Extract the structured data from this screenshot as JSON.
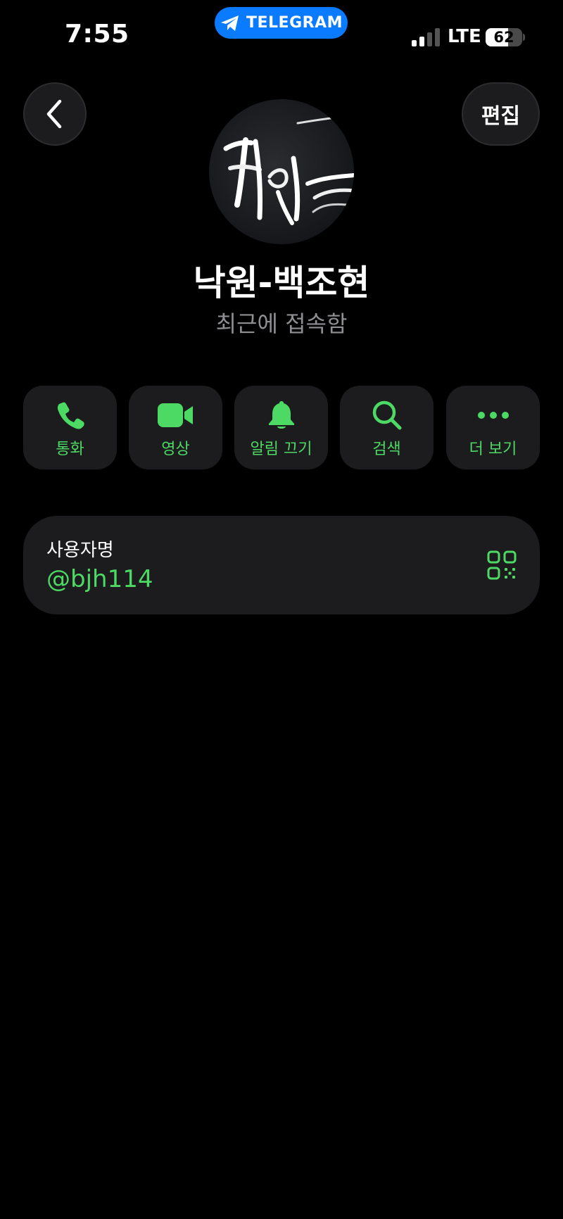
{
  "status_bar": {
    "time": "7:55",
    "app_pill": "TELEGRAM",
    "network": "LTE",
    "battery": "62",
    "battery_level": 0.62,
    "signal_bars": 2
  },
  "header": {
    "edit_label": "편집"
  },
  "profile": {
    "name": "낙원-백조현",
    "last_seen": "최근에 접속함"
  },
  "actions": [
    {
      "label": "통화",
      "icon": "phone-icon"
    },
    {
      "label": "영상",
      "icon": "video-icon"
    },
    {
      "label": "알림 끄기",
      "icon": "bell-icon"
    },
    {
      "label": "검색",
      "icon": "search-icon"
    },
    {
      "label": "더 보기",
      "icon": "more-icon"
    }
  ],
  "username_card": {
    "label": "사용자명",
    "value": "@bjh114",
    "icon": "qr-code-icon"
  },
  "colors": {
    "accent_green": "#4cd964",
    "telegram_blue": "#0a7aff",
    "tile_bg": "#1c1c1e",
    "background": "#000000",
    "secondary_text": "#8e8e93"
  }
}
